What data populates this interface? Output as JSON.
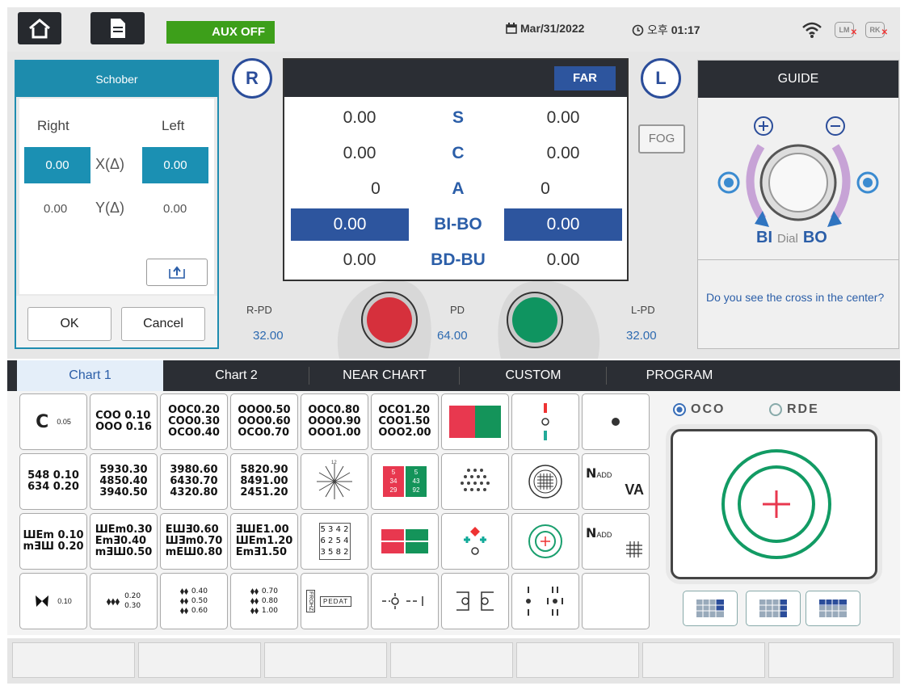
{
  "topbar": {
    "aux_label": "AUX OFF",
    "date": "Mar/31/2022",
    "time_prefix": "오후",
    "time": "01:17",
    "chip_lm": "LM",
    "chip_rk": "RK"
  },
  "dialog": {
    "title": "Schober",
    "right_label": "Right",
    "left_label": "Left",
    "x_label": "X(Δ)",
    "y_label": "Y(Δ)",
    "x_right": "0.00",
    "x_left": "0.00",
    "y_right": "0.00",
    "y_left": "0.00",
    "ok": "OK",
    "cancel": "Cancel"
  },
  "rx": {
    "right_circle": "R",
    "left_circle": "L",
    "mode": "FAR",
    "fog": "FOG",
    "rows": [
      {
        "label": "S",
        "right": "0.00",
        "left": "0.00"
      },
      {
        "label": "C",
        "right": "0.00",
        "left": "0.00"
      },
      {
        "label": "A",
        "right": "0",
        "left": "0"
      },
      {
        "label": "BI-BO",
        "right": "0.00",
        "left": "0.00"
      },
      {
        "label": "BD-BU",
        "right": "0.00",
        "left": "0.00"
      }
    ]
  },
  "pd": {
    "r_label": "R-PD",
    "r_value": "32.00",
    "pd_label": "PD",
    "pd_value": "64.00",
    "l_label": "L-PD",
    "l_value": "32.00"
  },
  "guide": {
    "title": "GUIDE",
    "bi": "BI",
    "dial": "Dial",
    "bo": "BO",
    "question": "Do you see the cross in the center?"
  },
  "tabs": [
    "Chart 1",
    "Chart 2",
    "NEAR CHART",
    "CUSTOM",
    "PROGRAM"
  ],
  "options": {
    "oco": "OCO",
    "rde": "RDE",
    "selected": "OCO"
  },
  "charts": {
    "c1_letter": "C",
    "c1_val": "0.05",
    "c2": "COO 0.10\nOOO 0.16",
    "c3": "OOC0.20\nCOO0.30\nOCO0.40",
    "c4": "OOO0.50\nOOO0.60\nOCO0.70",
    "c5": "OOC0.80\nOOO0.90\nOOO1.00",
    "c6": "OCO1.20\nCOO1.50\nOOO2.00",
    "n1": "548 0.10\n634 0.20",
    "n2": "5930.30\n4850.40\n3940.50",
    "n3": "3980.60\n6430.70\n4320.80",
    "n4": "5820.90\n8491.00\n2451.20",
    "clock_12": "12",
    "rg_left_top": "5",
    "rg_left_mid": "34",
    "rg_left_bot": "29",
    "rg_right_top": "5",
    "rg_right_mid": "43",
    "rg_right_bot": "92",
    "nadd": "N",
    "nadd_sub": "ADD",
    "va": "VA",
    "e1": "ШЕm 0.10\nmƎШ 0.20",
    "e2": "ШЕm0.30\nЕmƎ0.40\nmƎШ0.50",
    "e3": "ЕШƎ0.60\nШƎm0.70\nmЕШ0.80",
    "e4": "ƎШЕ1.00\nШЕm1.20\nЕmƎ1.50",
    "grid3": "5 3 4 2\n6 2 5 4\n3 5 8 2",
    "pedat": "PEDAT",
    "frohz": "FROHZ",
    "b1_val": "0.10",
    "b2": "0.20\n0.30",
    "b3": "0.40\n0.50\n0.60",
    "b4": "0.70\n0.80\n1.00"
  }
}
